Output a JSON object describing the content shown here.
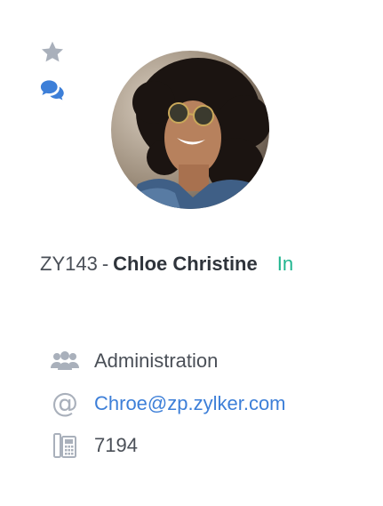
{
  "employee": {
    "id": "ZY143",
    "separator": "-",
    "name": "Chloe Christine",
    "status": "In"
  },
  "details": {
    "department": "Administration",
    "email": "Chroe@zp.zylker.com",
    "extension": "7194"
  },
  "icons": {
    "favorite": "star-icon",
    "chat": "chat-bubbles-icon",
    "department": "people-group-icon",
    "email": "at-sign-icon",
    "phone": "desk-phone-icon"
  },
  "colors": {
    "status_in": "#1fb58f",
    "link": "#3d7fd8",
    "chat_icon": "#3d7fd8",
    "icon_gray": "#a9b0bb"
  }
}
